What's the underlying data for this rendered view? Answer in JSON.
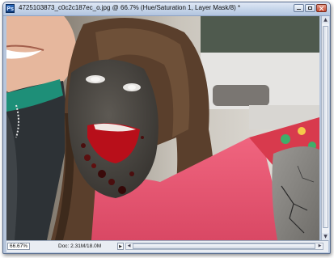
{
  "window": {
    "app_icon_label": "Ps",
    "title": "4725103873_c0c2c187ec_o.jpg @ 66.7% (Hue/Saturation 1, Layer Mask/8) *"
  },
  "canvas": {
    "icon": "document-image"
  },
  "status": {
    "zoom": "66.67%",
    "doc_info": "Doc: 2.31M/18.0M",
    "menu_arrow": "▶"
  },
  "scroll": {
    "up": "▲",
    "down": "▼",
    "left": "◀",
    "right": "▶"
  }
}
